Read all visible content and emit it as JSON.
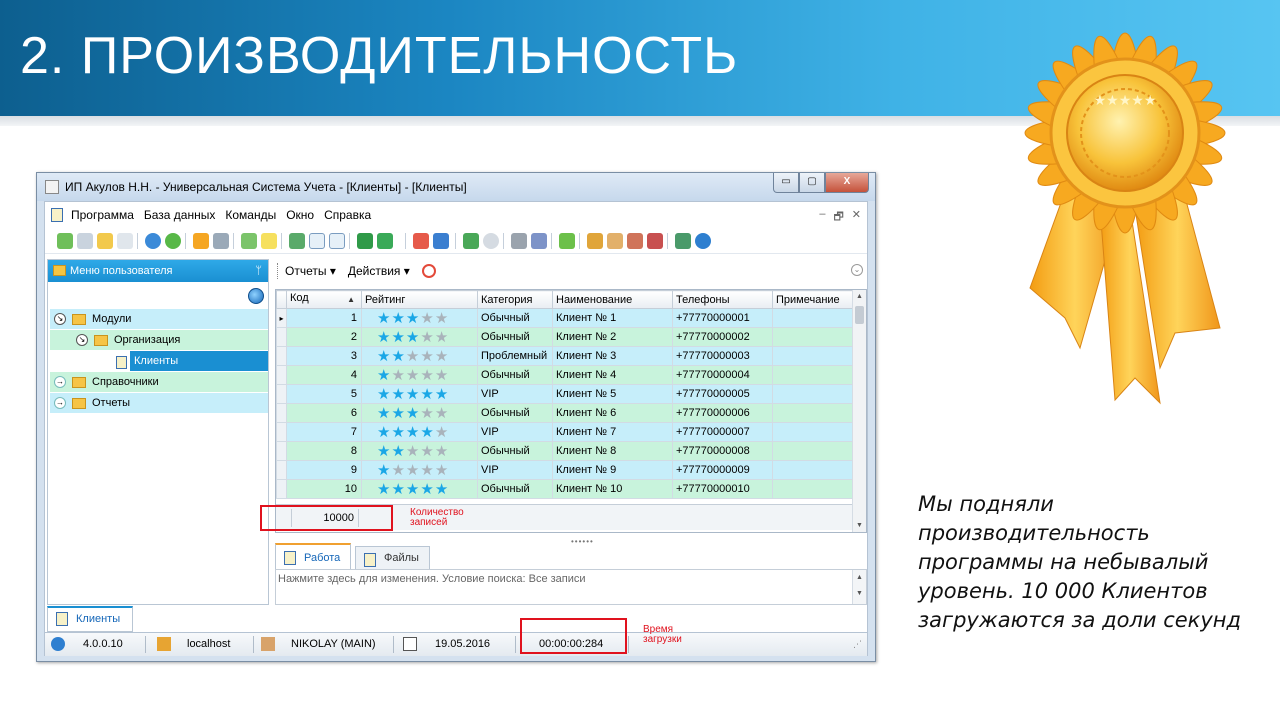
{
  "slide": {
    "title": "2. ПРОИЗВОДИТЕЛЬНОСТЬ",
    "caption_lines": [
      "Мы подняли",
      "производительность",
      "программы на небывалый",
      "уровень. 10 000 Клиентов",
      "загружаются за доли секунд"
    ]
  },
  "window": {
    "title": "ИП Акулов Н.Н. - Универсальная Система Учета - [Клиенты] - [Клиенты]",
    "controls": {
      "minimize": "▭",
      "maximize": "▢",
      "close": "X"
    }
  },
  "menubar": {
    "items": [
      "Программа",
      "База данных",
      "Команды",
      "Окно",
      "Справка"
    ],
    "mdi_controls": [
      "–",
      "🗗",
      "✕"
    ]
  },
  "left_pane": {
    "header": "Меню пользователя",
    "pin": "ᛘ",
    "tree": [
      {
        "label": "Модули",
        "expanded": true
      },
      {
        "label": "Организация",
        "expanded": true
      },
      {
        "label": "Клиенты",
        "selected": true
      },
      {
        "label": "Справочники",
        "expanded": false
      },
      {
        "label": "Отчеты",
        "expanded": false
      }
    ]
  },
  "right_toolbar": {
    "reports": "Отчеты",
    "actions": "Действия"
  },
  "grid": {
    "columns": [
      "Код",
      "Рейтинг",
      "Категория",
      "Наименование",
      "Телефоны",
      "Примечание"
    ],
    "rows": [
      {
        "code": "1",
        "rating": 3,
        "category": "Обычный",
        "name": "Клиент № 1",
        "phone": "+77770000001",
        "note": ""
      },
      {
        "code": "2",
        "rating": 3,
        "category": "Обычный",
        "name": "Клиент № 2",
        "phone": "+77770000002",
        "note": ""
      },
      {
        "code": "3",
        "rating": 2,
        "category": "Проблемный",
        "name": "Клиент № 3",
        "phone": "+77770000003",
        "note": ""
      },
      {
        "code": "4",
        "rating": 1,
        "category": "Обычный",
        "name": "Клиент № 4",
        "phone": "+77770000004",
        "note": ""
      },
      {
        "code": "5",
        "rating": 5,
        "category": "VIP",
        "name": "Клиент № 5",
        "phone": "+77770000005",
        "note": ""
      },
      {
        "code": "6",
        "rating": 3,
        "category": "Обычный",
        "name": "Клиент № 6",
        "phone": "+77770000006",
        "note": ""
      },
      {
        "code": "7",
        "rating": 4,
        "category": "VIP",
        "name": "Клиент № 7",
        "phone": "+77770000007",
        "note": ""
      },
      {
        "code": "8",
        "rating": 2,
        "category": "Обычный",
        "name": "Клиент № 8",
        "phone": "+77770000008",
        "note": ""
      },
      {
        "code": "9",
        "rating": 1,
        "category": "VIP",
        "name": "Клиент № 9",
        "phone": "+77770000009",
        "note": ""
      },
      {
        "code": "10",
        "rating": 5,
        "category": "Обычный",
        "name": "Клиент № 10",
        "phone": "+77770000010",
        "note": ""
      }
    ],
    "record_count": "10000",
    "star_color": "#1aa7e6",
    "row_colors": [
      "#c6eefa",
      "#c8f3dc"
    ]
  },
  "tabs": [
    {
      "label": "Работа",
      "active": true
    },
    {
      "label": "Файлы",
      "active": false
    }
  ],
  "condition_text": "Нажмите здесь для изменения. Условие поиска: Все записи",
  "bottom_tab": "Клиенты",
  "statusbar": {
    "version": "4.0.0.10",
    "server": "localhost",
    "user": "NIKOLAY (MAIN)",
    "date": "19.05.2016",
    "load_time": "00:00:00:284"
  },
  "annotations": {
    "count_note": [
      "Количество",
      "записей"
    ],
    "time_note": [
      "Время",
      "загрузки"
    ],
    "color": "#e0121e"
  }
}
